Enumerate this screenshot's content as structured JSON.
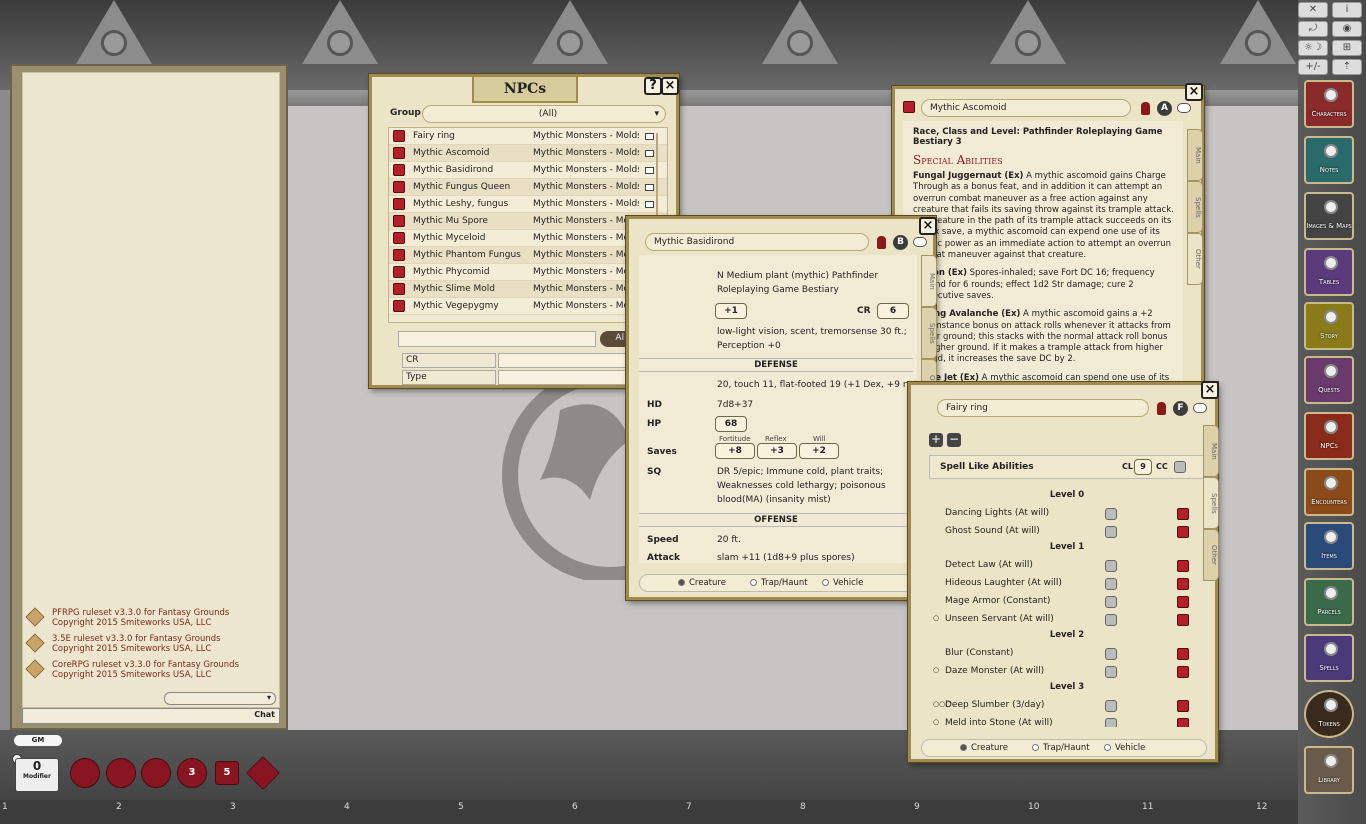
{
  "npcs_window": {
    "title": "NPCs",
    "help_label": "?",
    "close_label": "×",
    "group_label": "Group",
    "group_value": "(All)",
    "source": "Mythic Monsters - Molds, Sl",
    "items": [
      {
        "name": "Fairy ring"
      },
      {
        "name": "Mythic Ascomoid"
      },
      {
        "name": "Mythic Basidirond"
      },
      {
        "name": "Mythic Fungus Queen"
      },
      {
        "name": "Mythic Leshy, fungus"
      },
      {
        "name": "Mythic Mu Spore"
      },
      {
        "name": "Mythic Myceloid"
      },
      {
        "name": "Mythic Phantom Fungus"
      },
      {
        "name": "Mythic Phycomid"
      },
      {
        "name": "Mythic Slime Mold"
      },
      {
        "name": "Mythic Vegepygmy"
      }
    ],
    "search_value": "",
    "all_button": "All",
    "filters": [
      {
        "label": "CR",
        "value": ""
      },
      {
        "label": "Type",
        "value": ""
      }
    ]
  },
  "ascomoid_window": {
    "name": "Mythic Ascomoid",
    "badge": "A",
    "race_line": "Race, Class and Level: Pathfinder Roleplaying Game Bestiary 3",
    "heading": "Special Abilities",
    "paragraphs": [
      {
        "b": "Fungal Juggernaut (Ex)",
        "t": " A mythic ascomoid gains Charge Through as a bonus feat, and in addition it can attempt an overrun combat maneuver as a free action against any creature that fails its saving throw against its trample attack. If a creature in the path of its trample attack succeeds on its Reflex save, a mythic ascomoid can expend one use of its mythic power as an immediate action to attempt an overrun combat maneuver against that creature."
      },
      {
        "b": "Poison (Ex)",
        "t": " Spores-inhaled; save Fort DC 16; frequency 1/round for 6 rounds; effect 1d2 Str damage; cure 2 consecutive saves."
      },
      {
        "b": "Rolling Avalanche (Ex)",
        "t": " A mythic ascomoid gains a +2 circumstance bonus on attack rolls whenever it attacks from higher ground; this stacks with the normal attack roll bonus for higher ground. If it makes a trample attack from higher ground, it increases the save DC by 2."
      },
      {
        "b": "Spore Jet (Ex)",
        "t": " A mythic ascomoid can spend one use of its mythic power as a swift action to use its jet of spores to propel itself into the air. This produces a 10-foot radius cloud of spores centered on"
      }
    ],
    "tabs": [
      "Main",
      "Spells",
      "Other"
    ]
  },
  "basidirond_window": {
    "name": "Mythic Basidirond",
    "badge": "B",
    "type_line": "N Medium plant (mythic) Pathfinder Roleplaying Game Bestiary",
    "init": "+1",
    "cr_label": "CR",
    "cr": "6",
    "senses": "low-light vision, scent, tremorsense 30 ft.; Perception +0",
    "defense_header": "DEFENSE",
    "ac": "20, touch 11, flat-footed 19 (+1 Dex, +9 natural)",
    "hd_label": "HD",
    "hd": "7d8+37",
    "hp_label": "HP",
    "hp": "68",
    "saves_label": "Saves",
    "save_names": [
      "Fortitude",
      "Reflex",
      "Will"
    ],
    "save_values": [
      "+8",
      "+3",
      "+2"
    ],
    "sq_label": "SQ",
    "sq": "DR 5/epic; Immune cold, plant traits; Weaknesses cold lethargy; poisonous blood(MA) (insanity mist)",
    "offense_header": "OFFENSE",
    "speed_label": "Speed",
    "speed": "20 ft.",
    "attack_label": "Attack",
    "attack": "slam +11 (1d8+9 plus spores)",
    "bottom_tabs": [
      "Creature",
      "Trap/Haunt",
      "Vehicle"
    ],
    "tabs": [
      "Main",
      "Spells",
      "Other"
    ]
  },
  "fairy_window": {
    "name": "Fairy ring",
    "badge": "F",
    "sla_label": "Spell Like Abilities",
    "cl_label": "CL",
    "cl": "9",
    "cc_label": "CC",
    "rows": [
      {
        "kind": "level",
        "text": "Level 0"
      },
      {
        "kind": "spell",
        "text": "Dancing Lights (At will)",
        "prefix": ""
      },
      {
        "kind": "spell",
        "text": "Ghost Sound (At will)",
        "prefix": ""
      },
      {
        "kind": "level",
        "text": "Level 1"
      },
      {
        "kind": "spell",
        "text": "Detect Law (At will)",
        "prefix": ""
      },
      {
        "kind": "spell",
        "text": "Hideous Laughter (At will)",
        "prefix": ""
      },
      {
        "kind": "spell",
        "text": "Mage Armor (Constant)",
        "prefix": ""
      },
      {
        "kind": "spell",
        "text": "Unseen Servant (At will)",
        "prefix": "○"
      },
      {
        "kind": "level",
        "text": "Level 2"
      },
      {
        "kind": "spell",
        "text": "Blur (Constant)",
        "prefix": ""
      },
      {
        "kind": "spell",
        "text": "Daze Monster (At will)",
        "prefix": "○"
      },
      {
        "kind": "level",
        "text": "Level 3"
      },
      {
        "kind": "spell",
        "text": "Deep Slumber (3/day)",
        "prefix": "○○○"
      },
      {
        "kind": "spell",
        "text": "Meld into Stone (At will)",
        "prefix": "○"
      }
    ],
    "bottom_tabs": [
      "Creature",
      "Trap/Haunt",
      "Vehicle"
    ],
    "tabs": [
      "Main",
      "Spells",
      "Other"
    ]
  },
  "chat": {
    "messages": [
      {
        "line1": "PFRPG ruleset v3.3.0 for Fantasy Grounds",
        "line2": "Copyright 2015 Smiteworks USA, LLC"
      },
      {
        "line1": "3.5E ruleset v3.3.0 for Fantasy Grounds",
        "line2": "Copyright 2015 Smiteworks USA, LLC"
      },
      {
        "line1": "CoreRPG ruleset v3.3.0 for Fantasy Grounds",
        "line2": "Copyright 2015 Smiteworks USA, LLC"
      }
    ],
    "chat_button": "Chat",
    "input_value": ""
  },
  "bottom": {
    "gm_label": "GM",
    "modifier_value": "0",
    "modifier_label": "Modifier",
    "dice": [
      {
        "label": "",
        "icon": "d20-icon"
      },
      {
        "label": "",
        "icon": "d12-icon"
      },
      {
        "label": "",
        "icon": "d10-icon"
      },
      {
        "label": "3",
        "icon": "d8-icon"
      },
      {
        "label": "5",
        "icon": "d6-icon"
      },
      {
        "label": "",
        "icon": "d4-icon"
      }
    ],
    "ruler": [
      "1",
      "2",
      "3",
      "4",
      "5",
      "6",
      "7",
      "8",
      "9",
      "10",
      "11",
      "12"
    ]
  },
  "sidebar": {
    "tools": [
      "✕",
      "i",
      "⤾",
      "◉",
      "☼☽",
      "⊞",
      "+/-",
      "⇡"
    ],
    "buttons": [
      {
        "label": "Characters",
        "color": "#8a2a2a"
      },
      {
        "label": "Notes",
        "color": "#2a6a6a"
      },
      {
        "label": "Images & Maps",
        "color": "#444444"
      },
      {
        "label": "Tables",
        "color": "#5a3a7a"
      },
      {
        "label": "Story",
        "color": "#8a7a1a"
      },
      {
        "label": "Quests",
        "color": "#6a3a6a"
      },
      {
        "label": "NPCs",
        "color": "#8a2a1a"
      },
      {
        "label": "Encounters",
        "color": "#8a4a1a"
      },
      {
        "label": "Items",
        "color": "#2a4a7a"
      },
      {
        "label": "Parcels",
        "color": "#3a6a4a"
      },
      {
        "label": "Spells",
        "color": "#4a3a7a"
      },
      {
        "label": "Tokens",
        "color": "#5a4a3a"
      },
      {
        "label": "Library",
        "color": "#6a5a4a"
      }
    ]
  },
  "colors": {
    "parchment": "#ece4c6",
    "frame": "#a08a4e",
    "accent_red": "#b3202a"
  }
}
